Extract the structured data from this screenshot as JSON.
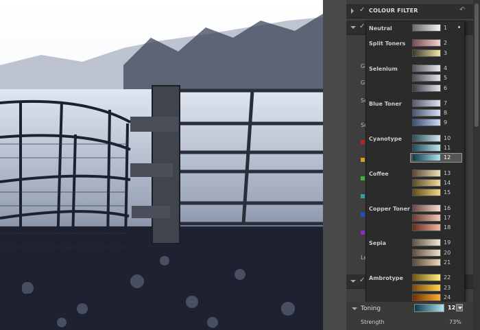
{
  "panel": {
    "header_title": "COLOUR FILTER",
    "side_labels": [
      "Gr",
      "Gr",
      "Se",
      "Se",
      "Le"
    ],
    "side_dot_colors": [
      "#c0221b",
      "#d6a21a",
      "#3ab53a",
      "#2aa5a5",
      "#1f4ecf",
      "#8a2ec8"
    ]
  },
  "dropdown": {
    "groups": [
      {
        "name": "Neutral",
        "swatches": [
          {
            "num": "1",
            "from": "#6a6a6a",
            "to": "#f4f4f4"
          }
        ]
      },
      {
        "name": "Split Toners",
        "swatches": [
          {
            "num": "2",
            "from": "#7a4a55",
            "to": "#f4d2c8"
          },
          {
            "num": "3",
            "from": "#3c3a2a",
            "to": "#f2e6a8"
          }
        ]
      },
      {
        "name": "Selenium",
        "swatches": [
          {
            "num": "4",
            "from": "#555560",
            "to": "#e8e8ec"
          },
          {
            "num": "5",
            "from": "#4c4c54",
            "to": "#e6e4e8"
          },
          {
            "num": "6",
            "from": "#3a3c44",
            "to": "#e2e4ea"
          }
        ]
      },
      {
        "name": "Blue Toner",
        "swatches": [
          {
            "num": "7",
            "from": "#545c6c",
            "to": "#dde4f0"
          },
          {
            "num": "8",
            "from": "#4a5670",
            "to": "#d6e0f2"
          },
          {
            "num": "9",
            "from": "#3c4c74",
            "to": "#cbdaf4"
          }
        ]
      },
      {
        "name": "Cyanotype",
        "swatches": [
          {
            "num": "10",
            "from": "#2e4e58",
            "to": "#cfe8ec"
          },
          {
            "num": "11",
            "from": "#1f4c5a",
            "to": "#bfe6ee"
          },
          {
            "num": "12",
            "from": "#0f3a4c",
            "to": "#aee4ee"
          }
        ]
      },
      {
        "name": "Coffee",
        "swatches": [
          {
            "num": "13",
            "from": "#5a4a34",
            "to": "#eee0b8"
          },
          {
            "num": "14",
            "from": "#5e4a26",
            "to": "#f0dc9a"
          },
          {
            "num": "15",
            "from": "#624a1c",
            "to": "#f2d684"
          }
        ]
      },
      {
        "name": "Copper Toner",
        "swatches": [
          {
            "num": "16",
            "from": "#6a4a42",
            "to": "#f6ddd2"
          },
          {
            "num": "17",
            "from": "#6e3a2e",
            "to": "#f4c8b6"
          },
          {
            "num": "18",
            "from": "#6a2a22",
            "to": "#f0b6a4"
          }
        ]
      },
      {
        "name": "Sepia",
        "swatches": [
          {
            "num": "19",
            "from": "#5e5446",
            "to": "#f0e6d4"
          },
          {
            "num": "20",
            "from": "#5e5040",
            "to": "#eee0c8"
          },
          {
            "num": "21",
            "from": "#5a4a38",
            "to": "#ecd8bc"
          }
        ]
      },
      {
        "name": "Ambrotype",
        "swatches": [
          {
            "num": "22",
            "from": "#6a5414",
            "to": "#fff080"
          },
          {
            "num": "23",
            "from": "#7a4a0c",
            "to": "#ffd050"
          },
          {
            "num": "24",
            "from": "#6e2e04",
            "to": "#ffb030"
          }
        ]
      }
    ],
    "selected": "12"
  },
  "toning": {
    "label": "Toning",
    "value": "12",
    "strength_label": "Strength",
    "strength_value": "73%",
    "strength_fraction": 0.73
  }
}
